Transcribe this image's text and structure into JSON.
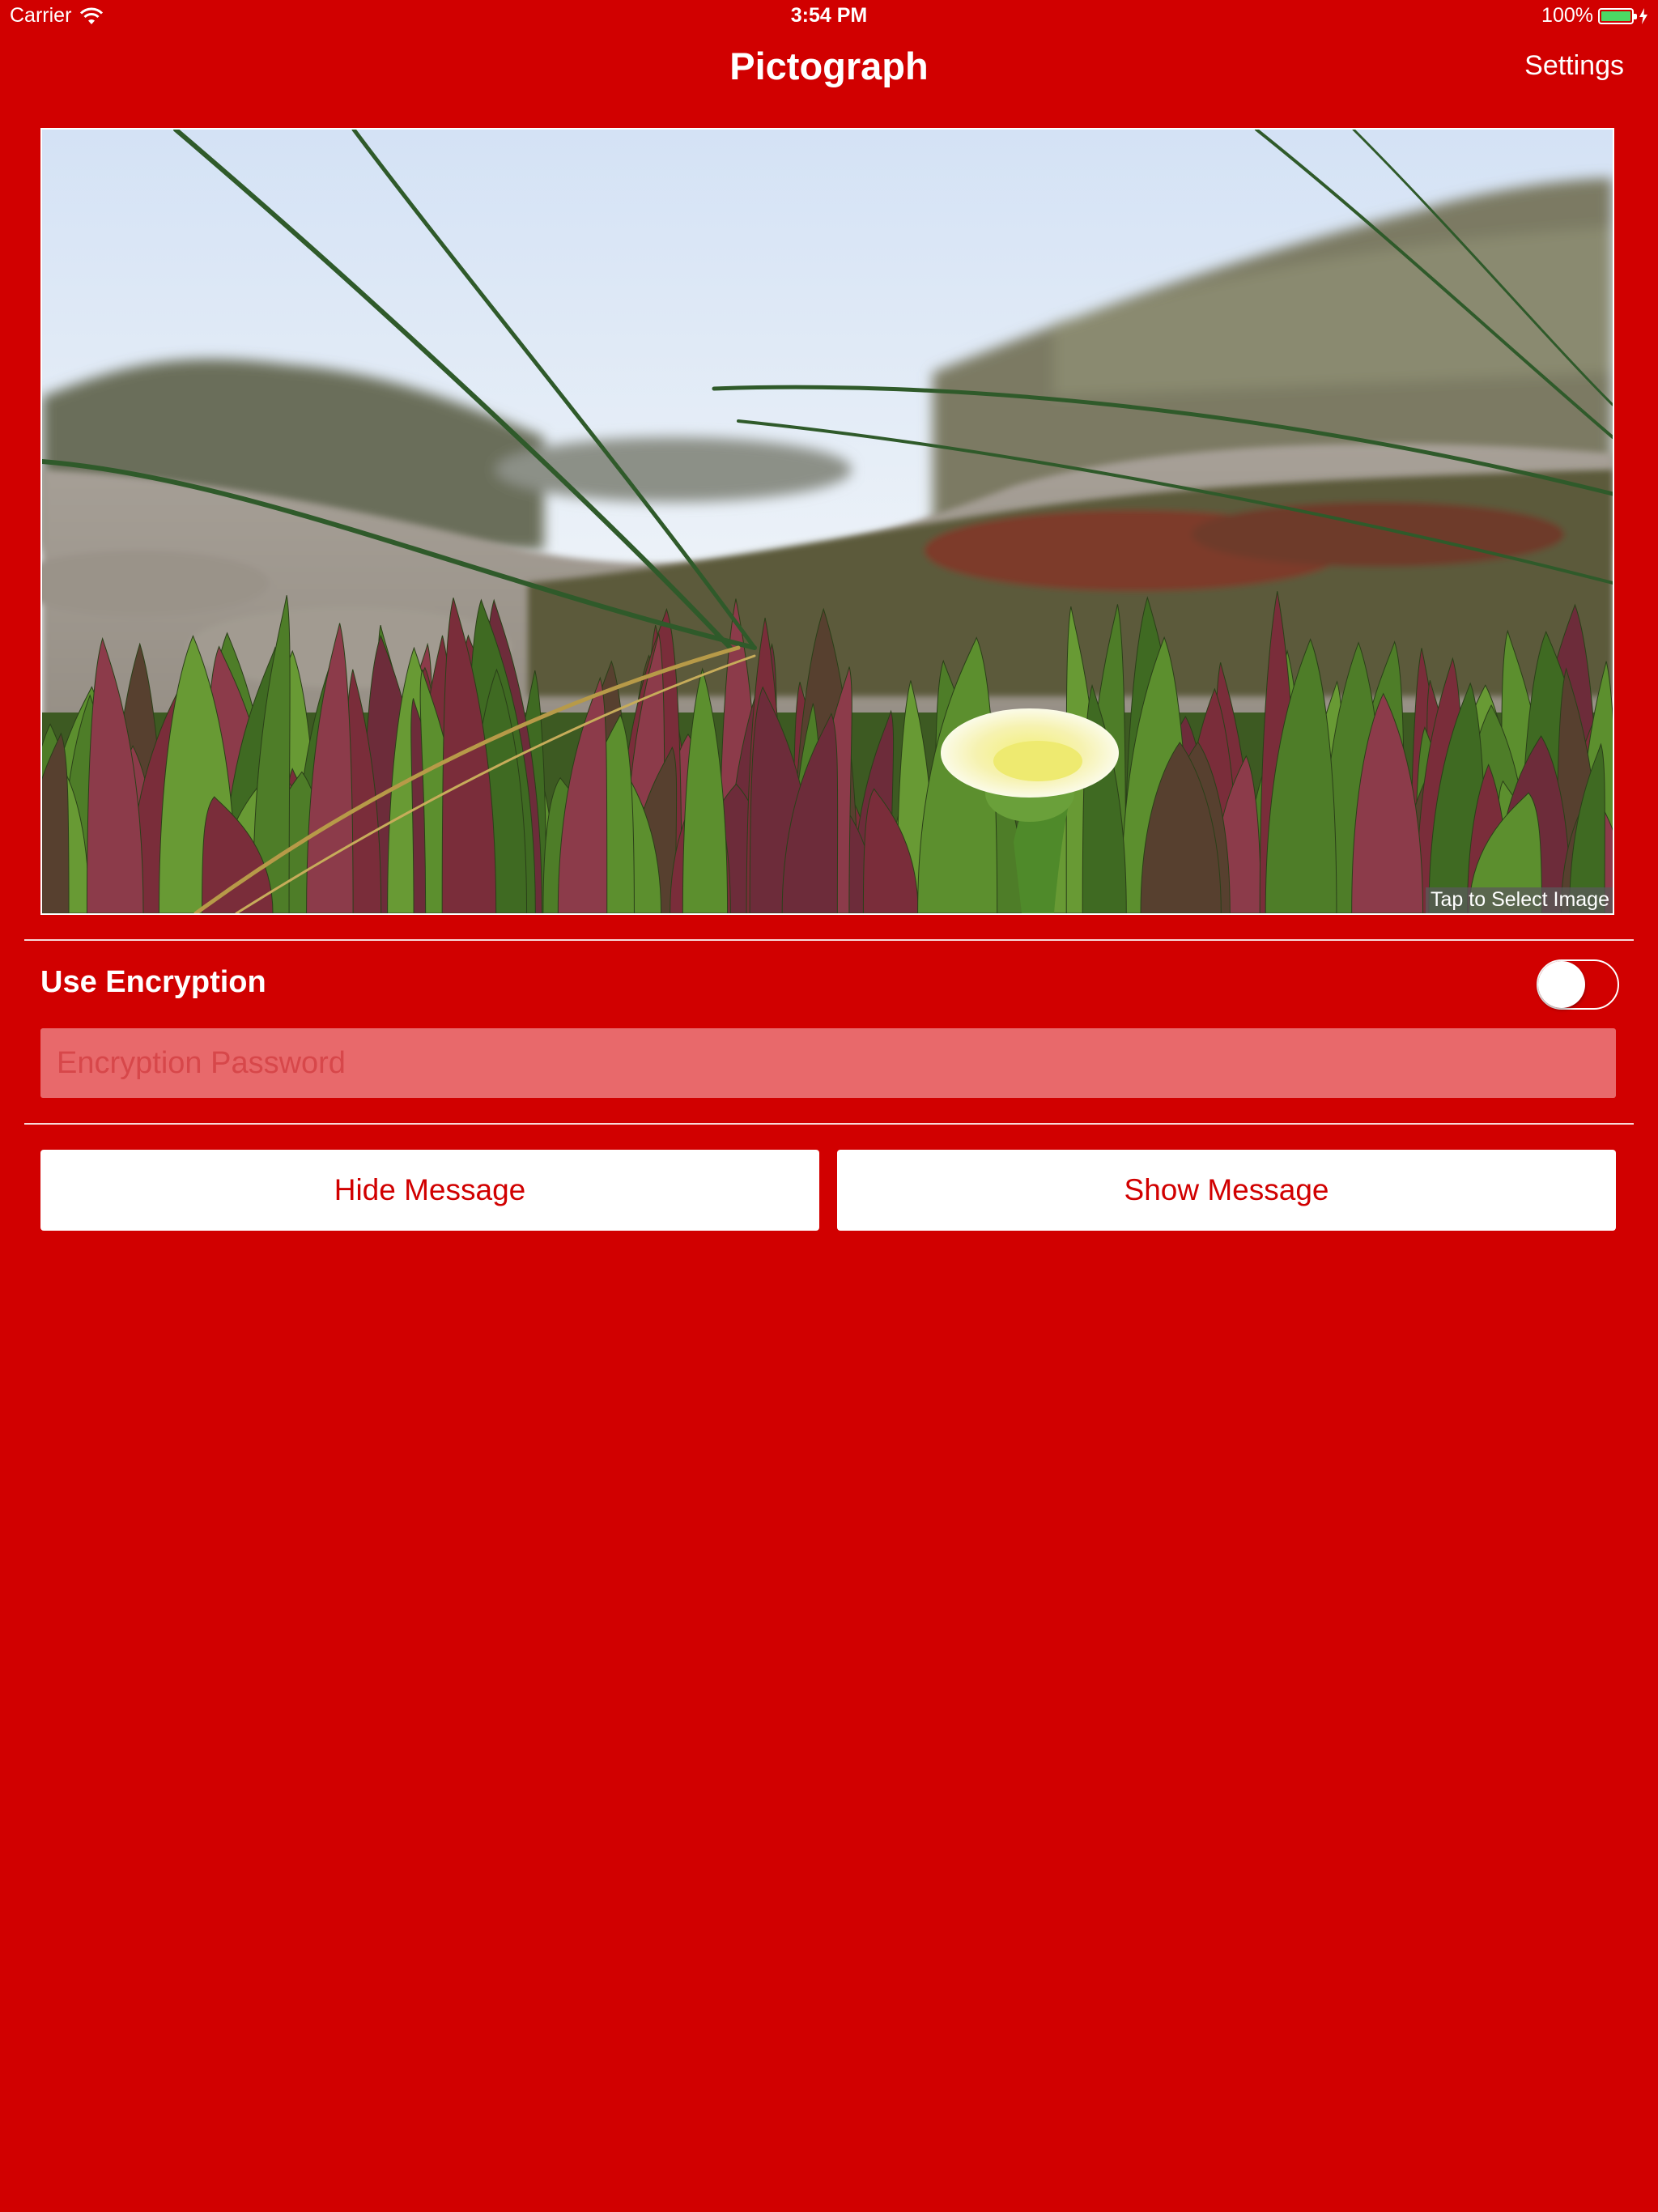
{
  "status_bar": {
    "carrier": "Carrier",
    "time": "3:54 PM",
    "battery_percent": "100%",
    "battery_level": 1.0,
    "battery_color": "#4cd964",
    "icons": [
      "wifi-icon",
      "battery-icon",
      "charging-icon"
    ]
  },
  "nav": {
    "title": "Pictograph",
    "settings_label": "Settings"
  },
  "image_picker": {
    "overlay_label": "Tap to Select Image",
    "photo_subject": "green succulent plants with a pale yellow flower and grass blades on a sandy dune"
  },
  "encryption": {
    "label": "Use Encryption",
    "toggle_on": false,
    "password_value": "",
    "password_placeholder": "Encryption Password"
  },
  "actions": {
    "hide_label": "Hide Message",
    "show_label": "Show Message"
  },
  "colors": {
    "background": "#d10000",
    "button_text": "#d10000",
    "input_background": "#e8696b",
    "input_placeholder": "#d7474a"
  }
}
